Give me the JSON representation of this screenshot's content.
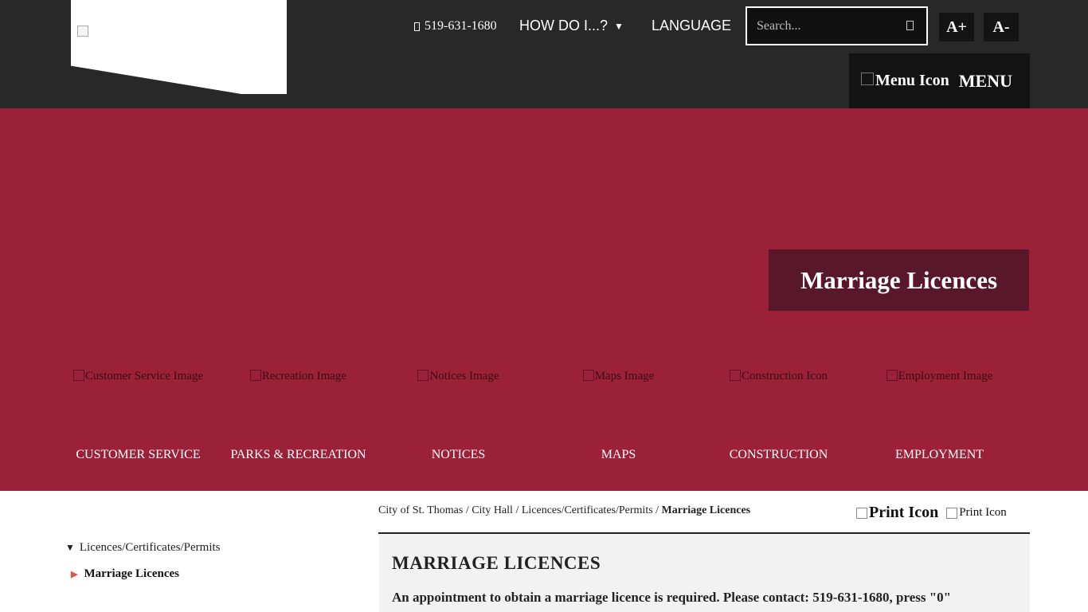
{
  "header": {
    "phone": "519-631-1680",
    "how_do_i": "HOW DO I...?",
    "language": "LANGUAGE",
    "search_placeholder": "Search...",
    "font_increase": "A+",
    "font_decrease": "A-",
    "menu_icon_alt": "Menu Icon",
    "menu_label": "MENU"
  },
  "hero": {
    "title": "Marriage Licences"
  },
  "quick_links": [
    {
      "alt": "Customer Service Image",
      "label": "CUSTOMER SERVICE"
    },
    {
      "alt": "Recreation Image",
      "label": "PARKS & RECREATION"
    },
    {
      "alt": "Notices Image",
      "label": "NOTICES"
    },
    {
      "alt": "Maps Image",
      "label": "MAPS"
    },
    {
      "alt": "Construction Icon",
      "label": "CONSTRUCTION"
    },
    {
      "alt": "Employment Image",
      "label": "EMPLOYMENT"
    }
  ],
  "breadcrumb": {
    "items": [
      "City of St. Thomas",
      "City Hall",
      "Licences/Certificates/Permits"
    ],
    "separator": "/",
    "current": "Marriage Licences"
  },
  "print": {
    "large_alt": "Print Icon",
    "small_alt": "Print Icon"
  },
  "sidebar": {
    "parent": "Licences/Certificates/Permits",
    "child": "Marriage Licences"
  },
  "content": {
    "heading": "MARRIAGE LICENCES",
    "intro": "An appointment to obtain a marriage licence is required. Please contact: 519-631-1680, press \"0\""
  }
}
